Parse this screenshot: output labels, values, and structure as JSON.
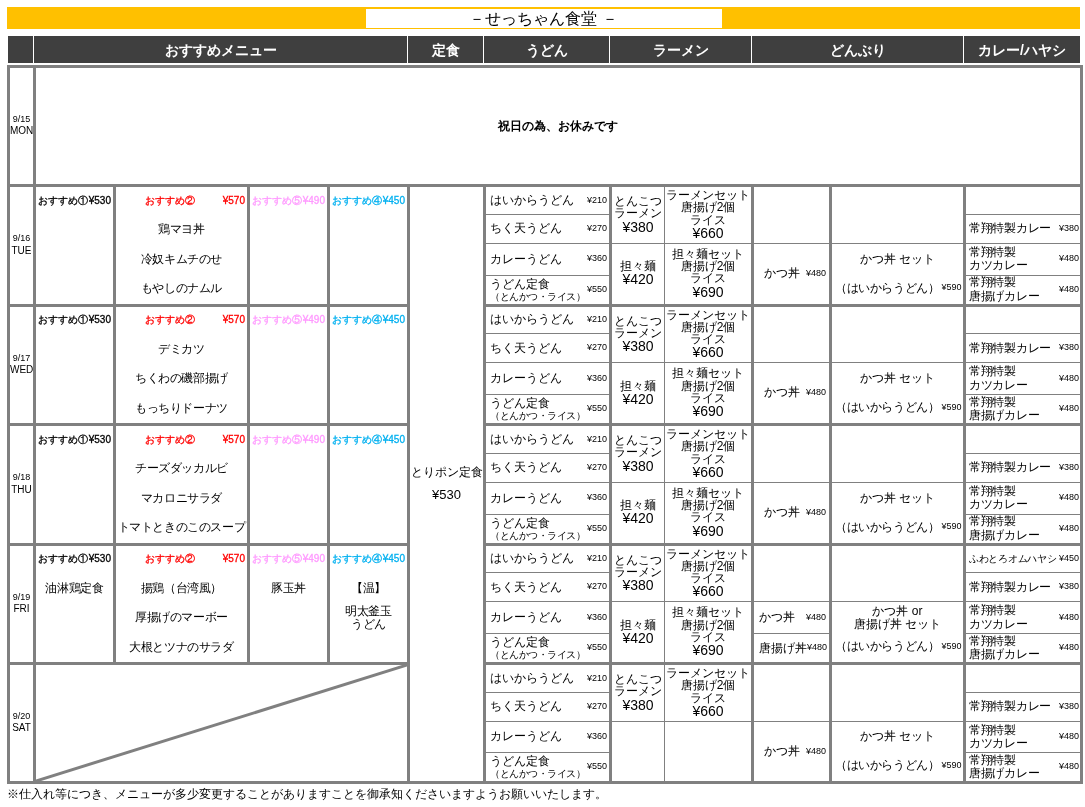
{
  "title": "－せっちゃん食堂 －",
  "columns": [
    "おすすめメニュー",
    "定食",
    "うどん",
    "ラーメン",
    "どんぶり",
    "カレー/ハヤシ"
  ],
  "set_meal": {
    "name": "とりポン定食",
    "price": "¥530"
  },
  "days": [
    {
      "date": "9/15",
      "weekday": "MON",
      "kind": "closed",
      "notice": "祝日の為、お休みです"
    },
    {
      "date": "9/16",
      "weekday": "TUE",
      "kind": "full",
      "specials": [
        {
          "label": "おすすめ①",
          "price": "¥530"
        },
        {
          "label": "おすすめ②",
          "price": "¥570",
          "color": "#ff0000",
          "items": [
            [
              "鶏マヨ丼"
            ],
            [
              "冷奴キムチのせ"
            ],
            [
              "もやしのナムル"
            ]
          ]
        },
        {
          "label": "おすすめ⑤",
          "price": "¥490",
          "color": "#ff99ff"
        },
        {
          "label": "おすすめ④",
          "price": "¥450",
          "color": "#00b0f0"
        }
      ],
      "udon": [
        {
          "name": "はいからうどん",
          "price": "¥210"
        },
        {
          "name": "ちく天うどん",
          "price": "¥270"
        },
        {
          "name": "カレーうどん",
          "price": "¥360"
        },
        {
          "name": "うどん定食",
          "note": "（とんかつ・ライス）",
          "price": "¥550"
        }
      ],
      "ramen": [
        {
          "dish": {
            "name": [
              "とんこつ",
              "ラーメン"
            ],
            "price": "¥380"
          },
          "set": {
            "name": [
              "ラーメンセット",
              "唐揚げ2個",
              "ライス"
            ],
            "price": "¥660"
          }
        },
        {
          "dish": {
            "name": [
              "担々麺"
            ],
            "price": "¥420"
          },
          "set": {
            "name": [
              "担々麺セット",
              "唐揚げ2個",
              "ライス"
            ],
            "price": "¥690"
          }
        }
      ],
      "donburi": {
        "bowls": [
          {
            "name": "かつ丼",
            "price": "¥480"
          }
        ],
        "set": {
          "name": [
            "かつ丼 セット"
          ],
          "note": "（はいからうどん）",
          "price": "¥590"
        }
      },
      "curry": [
        {
          "name": [
            "常翔特製カレー"
          ],
          "price": "¥380"
        },
        {
          "name": [
            "常翔特製",
            "カツカレー"
          ],
          "price": "¥480"
        },
        {
          "name": [
            "常翔特製",
            "唐揚げカレー"
          ],
          "price": "¥480"
        }
      ]
    },
    {
      "date": "9/17",
      "weekday": "WED",
      "kind": "full",
      "specials": [
        {
          "label": "おすすめ①",
          "price": "¥530"
        },
        {
          "label": "おすすめ②",
          "price": "¥570",
          "color": "#ff0000",
          "items": [
            [
              "デミカツ"
            ],
            [
              "ちくわの磯部揚げ"
            ],
            [
              "もっちりドーナツ"
            ]
          ]
        },
        {
          "label": "おすすめ⑤",
          "price": "¥490",
          "color": "#ff99ff"
        },
        {
          "label": "おすすめ④",
          "price": "¥450",
          "color": "#00b0f0"
        }
      ],
      "udon": [
        {
          "name": "はいからうどん",
          "price": "¥210"
        },
        {
          "name": "ちく天うどん",
          "price": "¥270"
        },
        {
          "name": "カレーうどん",
          "price": "¥360"
        },
        {
          "name": "うどん定食",
          "note": "（とんかつ・ライス）",
          "price": "¥550"
        }
      ],
      "ramen": [
        {
          "dish": {
            "name": [
              "とんこつ",
              "ラーメン"
            ],
            "price": "¥380"
          },
          "set": {
            "name": [
              "ラーメンセット",
              "唐揚げ2個",
              "ライス"
            ],
            "price": "¥660"
          }
        },
        {
          "dish": {
            "name": [
              "担々麺"
            ],
            "price": "¥420"
          },
          "set": {
            "name": [
              "担々麺セット",
              "唐揚げ2個",
              "ライス"
            ],
            "price": "¥690"
          }
        }
      ],
      "donburi": {
        "bowls": [
          {
            "name": "かつ丼",
            "price": "¥480"
          }
        ],
        "set": {
          "name": [
            "かつ丼 セット"
          ],
          "note": "（はいからうどん）",
          "price": "¥590"
        }
      },
      "curry": [
        {
          "name": [
            "常翔特製カレー"
          ],
          "price": "¥380"
        },
        {
          "name": [
            "常翔特製",
            "カツカレー"
          ],
          "price": "¥480"
        },
        {
          "name": [
            "常翔特製",
            "唐揚げカレー"
          ],
          "price": "¥480"
        }
      ]
    },
    {
      "date": "9/18",
      "weekday": "THU",
      "kind": "full",
      "specials": [
        {
          "label": "おすすめ①",
          "price": "¥530"
        },
        {
          "label": "おすすめ②",
          "price": "¥570",
          "color": "#ff0000",
          "items": [
            [
              "チーズダッカルビ"
            ],
            [
              "マカロニサラダ"
            ],
            [
              "トマトときのこのスープ"
            ]
          ]
        },
        {
          "label": "おすすめ⑤",
          "price": "¥490",
          "color": "#ff99ff"
        },
        {
          "label": "おすすめ④",
          "price": "¥450",
          "color": "#00b0f0"
        }
      ],
      "udon": [
        {
          "name": "はいからうどん",
          "price": "¥210"
        },
        {
          "name": "ちく天うどん",
          "price": "¥270"
        },
        {
          "name": "カレーうどん",
          "price": "¥360"
        },
        {
          "name": "うどん定食",
          "note": "（とんかつ・ライス）",
          "price": "¥550"
        }
      ],
      "ramen": [
        {
          "dish": {
            "name": [
              "とんこつ",
              "ラーメン"
            ],
            "price": "¥380"
          },
          "set": {
            "name": [
              "ラーメンセット",
              "唐揚げ2個",
              "ライス"
            ],
            "price": "¥660"
          }
        },
        {
          "dish": {
            "name": [
              "担々麺"
            ],
            "price": "¥420"
          },
          "set": {
            "name": [
              "担々麺セット",
              "唐揚げ2個",
              "ライス"
            ],
            "price": "¥690"
          }
        }
      ],
      "donburi": {
        "bowls": [
          {
            "name": "かつ丼",
            "price": "¥480"
          }
        ],
        "set": {
          "name": [
            "かつ丼 セット"
          ],
          "note": "（はいからうどん）",
          "price": "¥590"
        }
      },
      "curry": [
        {
          "name": [
            "常翔特製カレー"
          ],
          "price": "¥380"
        },
        {
          "name": [
            "常翔特製",
            "カツカレー"
          ],
          "price": "¥480"
        },
        {
          "name": [
            "常翔特製",
            "唐揚げカレー"
          ],
          "price": "¥480"
        }
      ]
    },
    {
      "date": "9/19",
      "weekday": "FRI",
      "kind": "full",
      "specials": [
        {
          "label": "おすすめ①",
          "price": "¥530",
          "items": [
            [
              "油淋鶏定食"
            ]
          ]
        },
        {
          "label": "おすすめ②",
          "price": "¥570",
          "color": "#ff0000",
          "items": [
            [
              "揚鶏（台湾風）"
            ],
            [
              "厚揚げのマーボー"
            ],
            [
              "大根とツナのサラダ"
            ]
          ]
        },
        {
          "label": "おすすめ⑤",
          "price": "¥490",
          "color": "#ff99ff",
          "items": [
            [
              "豚玉丼"
            ]
          ]
        },
        {
          "label": "おすすめ④",
          "price": "¥450",
          "color": "#00b0f0",
          "items": [
            [
              "【温】"
            ],
            [
              "明太釜玉",
              "うどん"
            ]
          ]
        }
      ],
      "udon": [
        {
          "name": "はいからうどん",
          "price": "¥210"
        },
        {
          "name": "ちく天うどん",
          "price": "¥270"
        },
        {
          "name": "カレーうどん",
          "price": "¥360"
        },
        {
          "name": "うどん定食",
          "note": "（とんかつ・ライス）",
          "price": "¥550"
        }
      ],
      "ramen": [
        {
          "dish": {
            "name": [
              "とんこつ",
              "ラーメン"
            ],
            "price": "¥380"
          },
          "set": {
            "name": [
              "ラーメンセット",
              "唐揚げ2個",
              "ライス"
            ],
            "price": "¥660"
          }
        },
        {
          "dish": {
            "name": [
              "担々麺"
            ],
            "price": "¥420"
          },
          "set": {
            "name": [
              "担々麺セット",
              "唐揚げ2個",
              "ライス"
            ],
            "price": "¥690"
          }
        }
      ],
      "donburi": {
        "bowls": [
          {
            "name": "かつ丼",
            "price": "¥480"
          },
          {
            "name": "唐揚げ丼",
            "price": "¥480"
          }
        ],
        "set": {
          "name": [
            "かつ丼 or",
            "唐揚げ丼 セット"
          ],
          "note": "（はいからうどん）",
          "price": "¥590"
        }
      },
      "curry": [
        {
          "name": [
            "ふわとろオムハヤシ"
          ],
          "price": "¥450"
        },
        {
          "name": [
            "常翔特製カレー"
          ],
          "price": "¥380"
        },
        {
          "name": [
            "常翔特製",
            "カツカレー"
          ],
          "price": "¥480"
        },
        {
          "name": [
            "常翔特製",
            "唐揚げカレー"
          ],
          "price": "¥480"
        }
      ]
    },
    {
      "date": "9/20",
      "weekday": "SAT",
      "kind": "no_specials",
      "udon": [
        {
          "name": "はいからうどん",
          "price": "¥210"
        },
        {
          "name": "ちく天うどん",
          "price": "¥270"
        },
        {
          "name": "カレーうどん",
          "price": "¥360"
        },
        {
          "name": "うどん定食",
          "note": "（とんかつ・ライス）",
          "price": "¥550"
        }
      ],
      "ramen": [
        {
          "dish": {
            "name": [
              "とんこつ",
              "ラーメン"
            ],
            "price": "¥380"
          },
          "set": {
            "name": [
              "ラーメンセット",
              "唐揚げ2個",
              "ライス"
            ],
            "price": "¥660"
          }
        }
      ],
      "donburi": {
        "bowls": [
          {
            "name": "かつ丼",
            "price": "¥480"
          }
        ],
        "set": {
          "name": [
            "かつ丼 セット"
          ],
          "note": "（はいからうどん）",
          "price": "¥590"
        }
      },
      "curry": [
        {
          "name": [
            "常翔特製カレー"
          ],
          "price": "¥380"
        },
        {
          "name": [
            "常翔特製",
            "カツカレー"
          ],
          "price": "¥480"
        },
        {
          "name": [
            "常翔特製",
            "唐揚げカレー"
          ],
          "price": "¥480"
        }
      ]
    }
  ],
  "footnote": "※仕入れ等につき、メニューが多少変更することがありますことを御承知くださいますようお願いいたします。"
}
